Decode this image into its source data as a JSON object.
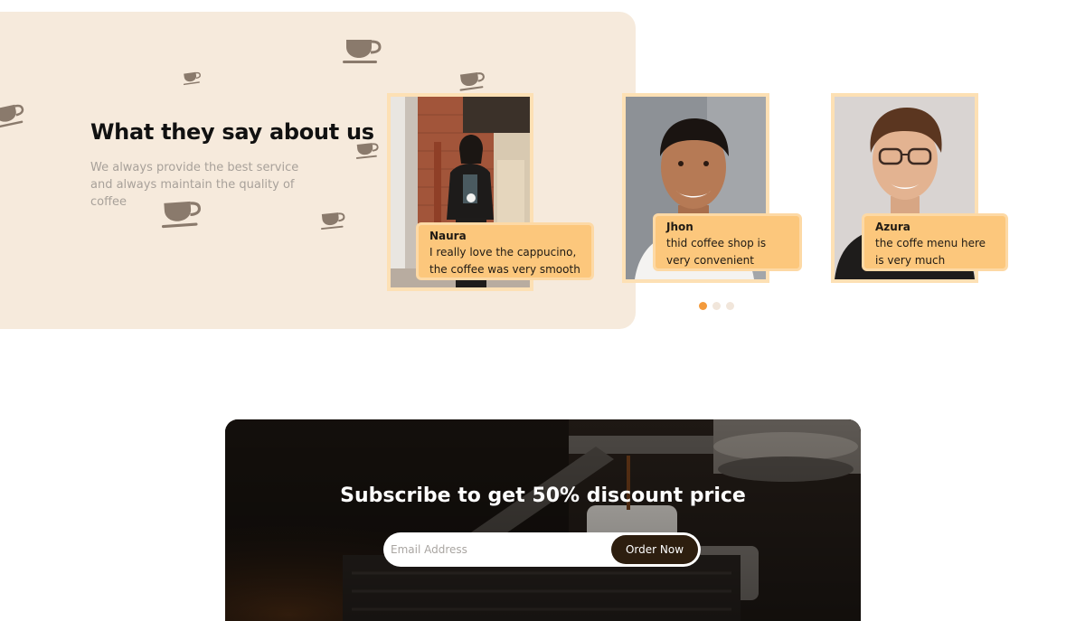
{
  "testimonials_section": {
    "heading": "What they say about us",
    "subtitle": "We always provide the best service and always maintain the quality of coffee",
    "decoration_icon": "coffee-cup-icon",
    "testimonials": [
      {
        "name": "Naura",
        "text": "I really love the cappucino, the coffee was very smooth"
      },
      {
        "name": "Jhon",
        "text": "thid coffee shop is very convenient"
      },
      {
        "name": "Azura",
        "text": "the coffe menu here is very much"
      }
    ],
    "carousel": {
      "total_pages": 3,
      "active_page": 1
    },
    "colors": {
      "panel_bg": "#f6eadc",
      "bubble_bg": "#fcc77c",
      "card_border": "#fde0b4",
      "dot_active": "#f39a3c",
      "dot_inactive": "#f1e6db"
    }
  },
  "subscribe_section": {
    "title": "Subscribe to get 50% discount price",
    "email_placeholder": "Email Address",
    "button_label": "Order Now",
    "colors": {
      "button_bg": "#2d1e0f"
    }
  }
}
